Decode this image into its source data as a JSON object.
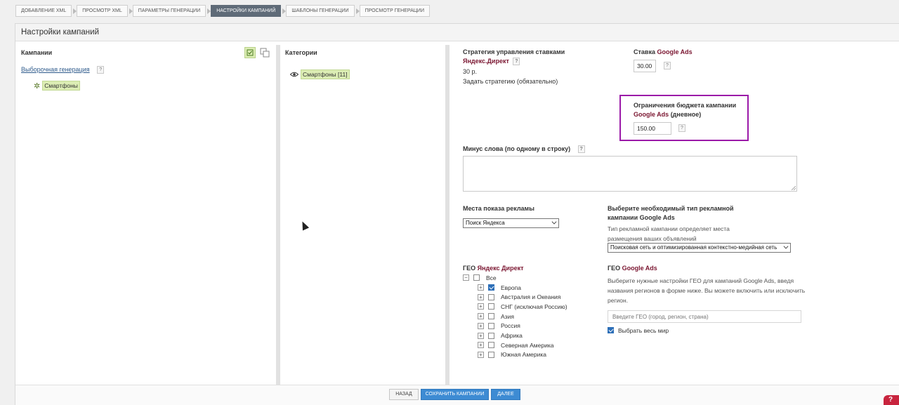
{
  "steps": [
    {
      "label": "ДОБАВЛЕНИЕ XML",
      "active": false
    },
    {
      "label": "ПРОСМОТР XML",
      "active": false
    },
    {
      "label": "ПАРАМЕТРЫ ГЕНЕРАЦИИ",
      "active": false
    },
    {
      "label": "НАСТРОЙКИ КАМПАНИЙ",
      "active": true
    },
    {
      "label": "ШАБЛОНЫ ГЕНЕРАЦИИ",
      "active": false
    },
    {
      "label": "ПРОСМОТР ГЕНЕРАЦИИ",
      "active": false
    }
  ],
  "panel": {
    "title": "Настройки кампаний"
  },
  "campaigns": {
    "title": "Кампании",
    "link": "Выборочная генерация",
    "item": "Смартфоны"
  },
  "categories": {
    "title": "Категории",
    "item": "Смартфоны [11]"
  },
  "strategy": {
    "title": "Стратегия управления ставками",
    "brand": "Яндекс.Директ",
    "value": "30 р.",
    "link": "Задать стратегию (обязательно)"
  },
  "bid": {
    "label": "Ставка",
    "brand": "Google Ads",
    "value": "30.00"
  },
  "budget": {
    "line1": "Ограничения бюджета кампании",
    "brand": "Google Ads",
    "suffix": "(дневное)",
    "value": "150.00"
  },
  "negative": {
    "label": "Минус слова (по одному в строку)"
  },
  "placement": {
    "label": "Места показа рекламы",
    "selected": "Поиск Яндекса"
  },
  "campaign_type": {
    "line1": "Выберите необходимый тип рекламной",
    "line2": "кампании Google Ads",
    "desc1": "Тип рекламной кампании определяет места",
    "desc2": "размещения ваших объявлений",
    "selected": "Поисковая сеть и оптимизированная контекстно-медийная сеть"
  },
  "geo_yandex": {
    "label": "ГЕО",
    "brand": "Яндекс Директ",
    "all": "Все",
    "regions": [
      {
        "name": "Европа",
        "checked": true
      },
      {
        "name": "Австралия и Океания",
        "checked": false
      },
      {
        "name": "СНГ (исключая Россию)",
        "checked": false
      },
      {
        "name": "Азия",
        "checked": false
      },
      {
        "name": "Россия",
        "checked": false
      },
      {
        "name": "Африка",
        "checked": false
      },
      {
        "name": "Северная Америка",
        "checked": false
      },
      {
        "name": "Южная Америка",
        "checked": false
      }
    ]
  },
  "geo_google": {
    "label": "ГЕО",
    "brand": "Google Ads",
    "desc1": "Выберите нужные настройки ГЕО для кампаний Google Ads, введя",
    "desc2": "названия регионов в форме ниже. Вы можете включить или исключить",
    "desc3": "регион.",
    "placeholder": "Введите ГЕО (город, регион, страна)",
    "world": "Выбрать весь мир"
  },
  "footer": {
    "back": "НАЗАД",
    "save": "СОХРАНИТЬ КАМПАНИИ",
    "next": "ДАЛЕЕ"
  },
  "help_glyph": "?",
  "colors": {
    "brand": "#7a1530",
    "accent": "#3d8bd3",
    "highlight": "#9b1aa8",
    "chip": "#dcedb4"
  }
}
